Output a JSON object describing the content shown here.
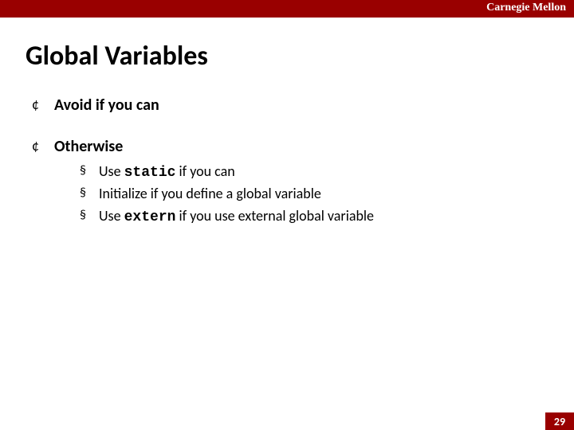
{
  "brand": "Carnegie Mellon",
  "title": "Global Variables",
  "bullets": [
    {
      "text": "Avoid if you can",
      "sub": []
    },
    {
      "text": "Otherwise",
      "sub": [
        {
          "pre": "Use ",
          "code": "static",
          "post": " if you can"
        },
        {
          "pre": "Initialize if you define a global variable",
          "code": "",
          "post": ""
        },
        {
          "pre": "Use ",
          "code": "extern",
          "post": " if you use external global variable"
        }
      ]
    }
  ],
  "page_number": "29",
  "colors": {
    "accent": "#990000"
  }
}
